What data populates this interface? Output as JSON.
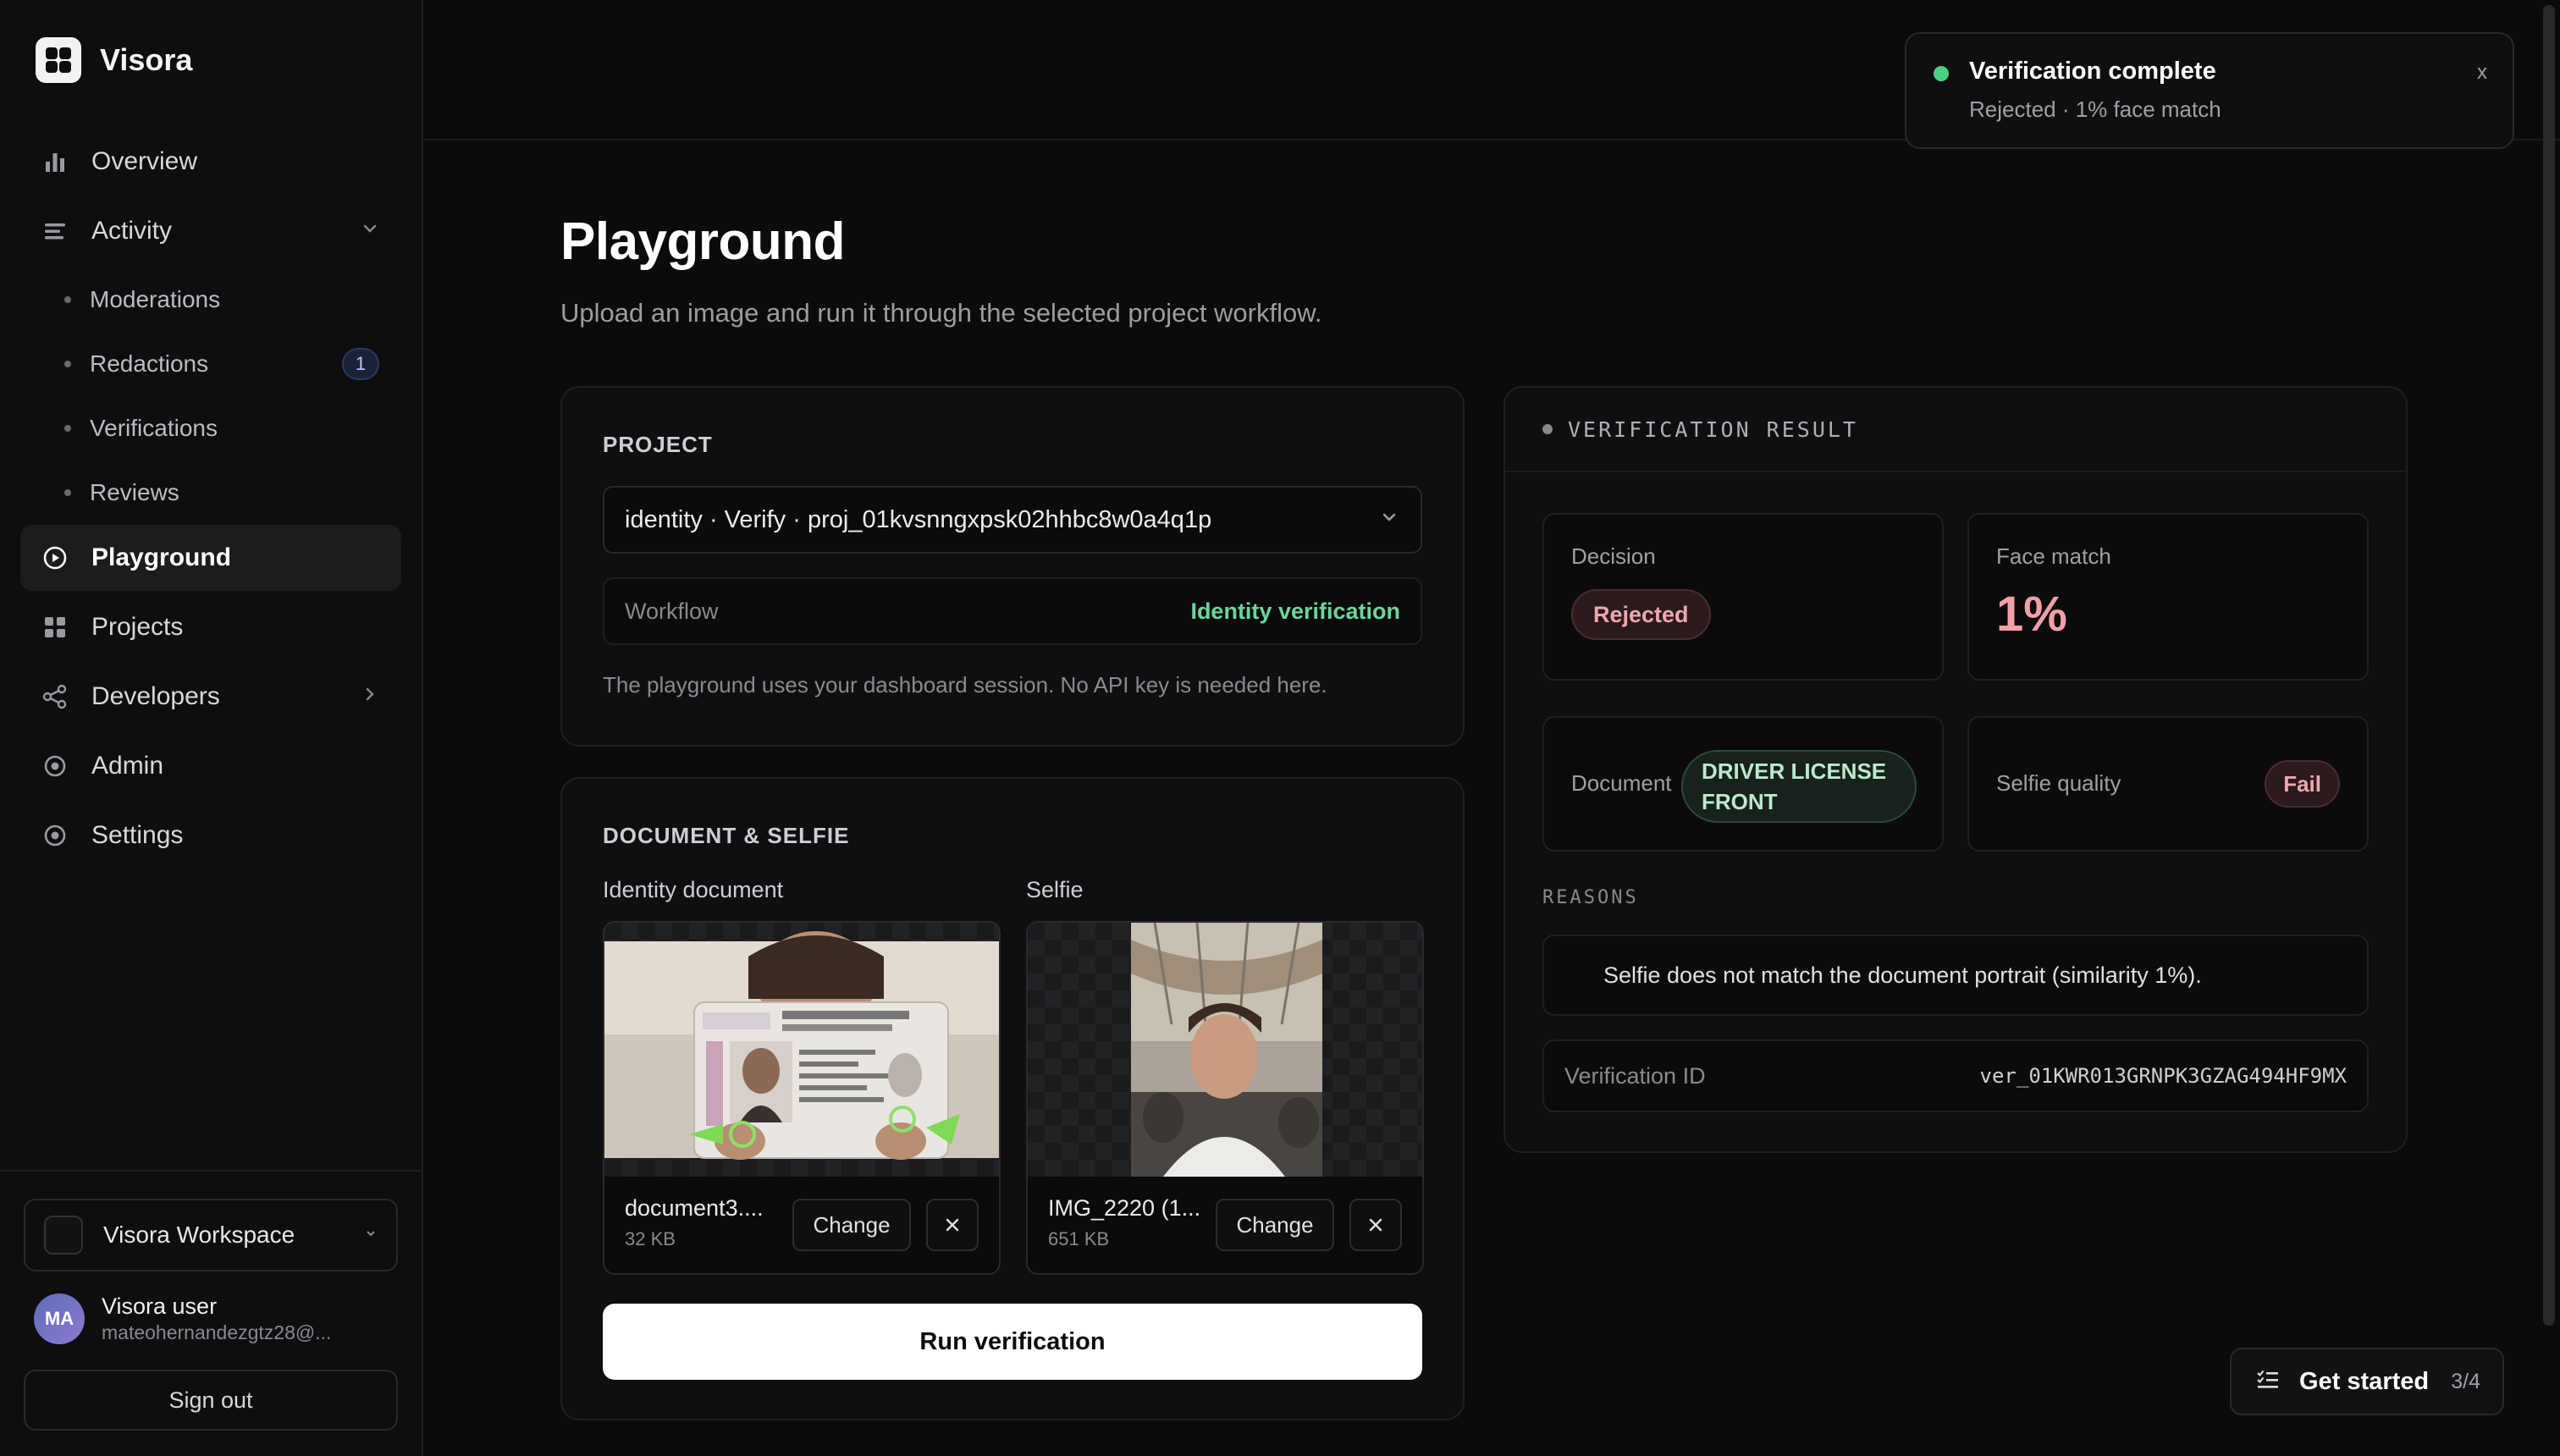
{
  "brand": {
    "name": "Visora"
  },
  "nav": {
    "overview": "Overview",
    "activity": "Activity",
    "activity_sub": [
      {
        "label": "Moderations",
        "badge": ""
      },
      {
        "label": "Redactions",
        "badge": "1"
      },
      {
        "label": "Verifications",
        "badge": ""
      },
      {
        "label": "Reviews",
        "badge": ""
      }
    ],
    "playground": "Playground",
    "projects": "Projects",
    "developers": "Developers",
    "admin": "Admin",
    "settings": "Settings"
  },
  "workspace": {
    "name": "Visora Workspace"
  },
  "user": {
    "initials": "MA",
    "name": "Visora user",
    "email": "mateohernandezgtz28@..."
  },
  "signout": "Sign out",
  "page": {
    "title": "Playground",
    "subtitle": "Upload an image and run it through the selected project workflow."
  },
  "project": {
    "label": "PROJECT",
    "selected": "identity · Verify · proj_01kvsnngxpsk02hhbc8w0a4q1p",
    "workflow_label": "Workflow",
    "workflow_value": "Identity verification",
    "hint": "The playground uses your dashboard session. No API key is needed here."
  },
  "docselfie": {
    "label": "DOCUMENT & SELFIE",
    "doc_label": "Identity document",
    "doc_file": "document3....",
    "doc_size": "32 KB",
    "selfie_label": "Selfie",
    "selfie_file": "IMG_2220 (1...",
    "selfie_size": "651 KB",
    "change": "Change",
    "run": "Run verification"
  },
  "result": {
    "header": "VERIFICATION RESULT",
    "decision_label": "Decision",
    "decision_value": "Rejected",
    "face_label": "Face match",
    "face_value": "1%",
    "document_label": "Document",
    "document_value": "DRIVER LICENSE FRONT",
    "selfie_label": "Selfie quality",
    "selfie_value": "Fail",
    "reasons_label": "REASONS",
    "reason": "Selfie does not match the document portrait (similarity 1%).",
    "vid_label": "Verification ID",
    "vid_value": "ver_01KWR013GRNPK3GZAG494HF9MX"
  },
  "toast": {
    "title": "Verification complete",
    "subtitle": "Rejected · 1% face match",
    "close": "x"
  },
  "getstarted": {
    "label": "Get started",
    "count": "3/4"
  },
  "colors": {
    "accent_green": "#6dd59a",
    "reject": "#f0a6ae",
    "bg": "#0b0b0c"
  }
}
